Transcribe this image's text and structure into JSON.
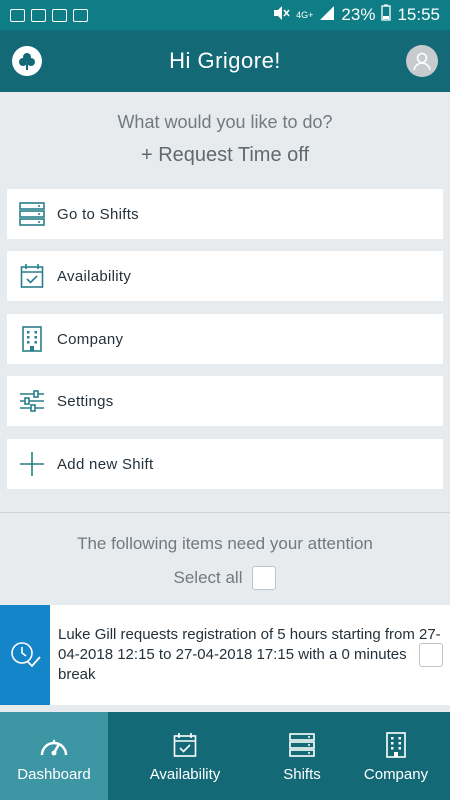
{
  "status_bar": {
    "network": "4G+",
    "battery": "23%",
    "time": "15:55"
  },
  "header": {
    "title": "Hi Grigore!",
    "logo_icon": "clover-icon",
    "avatar_icon": "user-icon"
  },
  "prompt": "What would you like to do?",
  "request_time_off": "+ Request Time off",
  "menu": [
    {
      "label": "Go to Shifts",
      "icon": "server-rack-icon"
    },
    {
      "label": "Availability",
      "icon": "calendar-check-icon"
    },
    {
      "label": "Company",
      "icon": "building-icon"
    },
    {
      "label": "Settings",
      "icon": "sliders-icon"
    },
    {
      "label": "Add new Shift",
      "icon": "plus-icon"
    }
  ],
  "attention": {
    "title": "The following items need your attention",
    "select_all": "Select all",
    "items": [
      {
        "text": "Luke Gill requests registration of 5 hours starting from 27-04-2018 12:15 to 27-04-2018 17:15 with a 0 minutes break",
        "icon": "clock-check-icon"
      }
    ]
  },
  "tabs": [
    {
      "label": "Dashboard",
      "icon": "gauge-icon",
      "active": true
    },
    {
      "label": "Availability",
      "icon": "calendar-check-icon",
      "active": false
    },
    {
      "label": "Shifts",
      "icon": "server-rack-icon",
      "active": false
    },
    {
      "label": "Company",
      "icon": "building-icon",
      "active": false
    }
  ],
  "colors": {
    "accent": "#136a76",
    "status": "#0f7d86",
    "attention_blue": "#1585c9",
    "icon_teal": "#2a7f8c"
  }
}
